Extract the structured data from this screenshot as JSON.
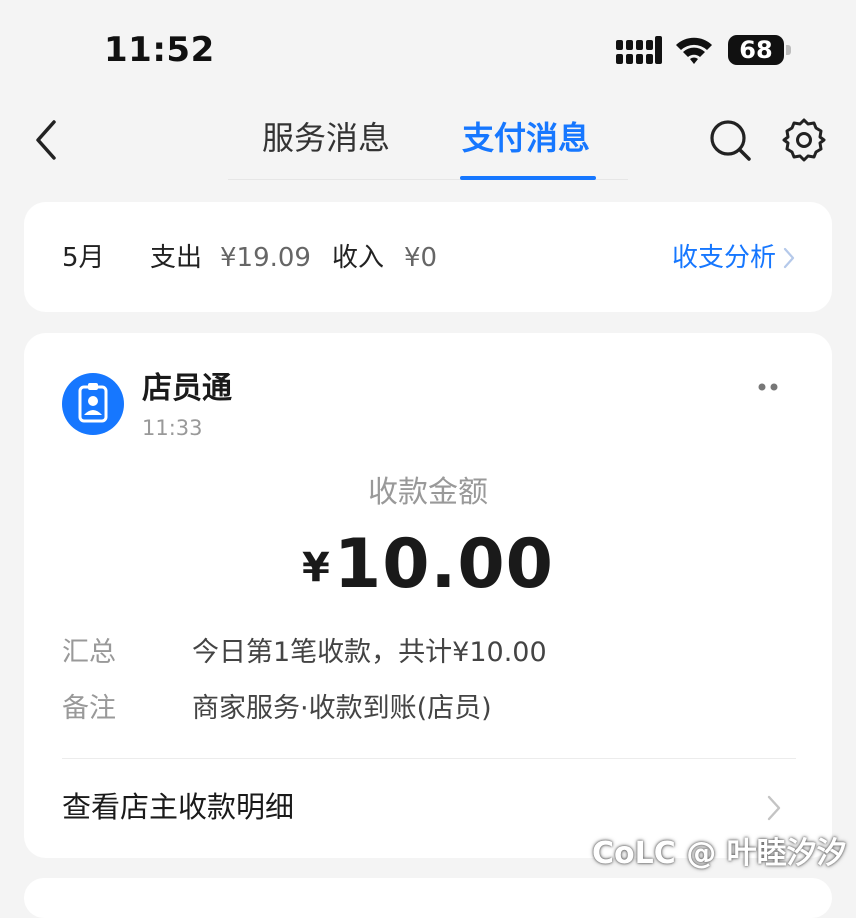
{
  "status_bar": {
    "time": "11:52",
    "battery": "68",
    "icons": [
      "signal-icon",
      "wifi-icon",
      "battery-icon"
    ]
  },
  "nav": {
    "back_icon": "chevron-left-icon",
    "tabs": [
      {
        "label": "服务消息",
        "active": false
      },
      {
        "label": "支付消息",
        "active": true
      }
    ],
    "search_icon": "search-icon",
    "settings_icon": "gear-icon"
  },
  "summary": {
    "month": "5月",
    "expense_label": "支出",
    "expense_value": "¥19.09",
    "income_label": "收入",
    "income_value": "¥0",
    "analysis_link": "收支分析"
  },
  "message": {
    "app_name": "店员通",
    "time": "11:33",
    "amount_label": "收款金额",
    "currency": "¥",
    "amount": "10.00",
    "details": [
      {
        "key": "汇总",
        "value": "今日第1笔收款，共计¥10.00"
      },
      {
        "key": "备注",
        "value": "商家服务·收款到账(店员)"
      }
    ],
    "detail_link": "查看店主收款明细"
  },
  "watermark": "CoLC @ 叶睦汐汐",
  "colors": {
    "accent": "#1677ff",
    "background": "#f4f4f4",
    "card": "#ffffff",
    "muted_text": "#999999"
  }
}
